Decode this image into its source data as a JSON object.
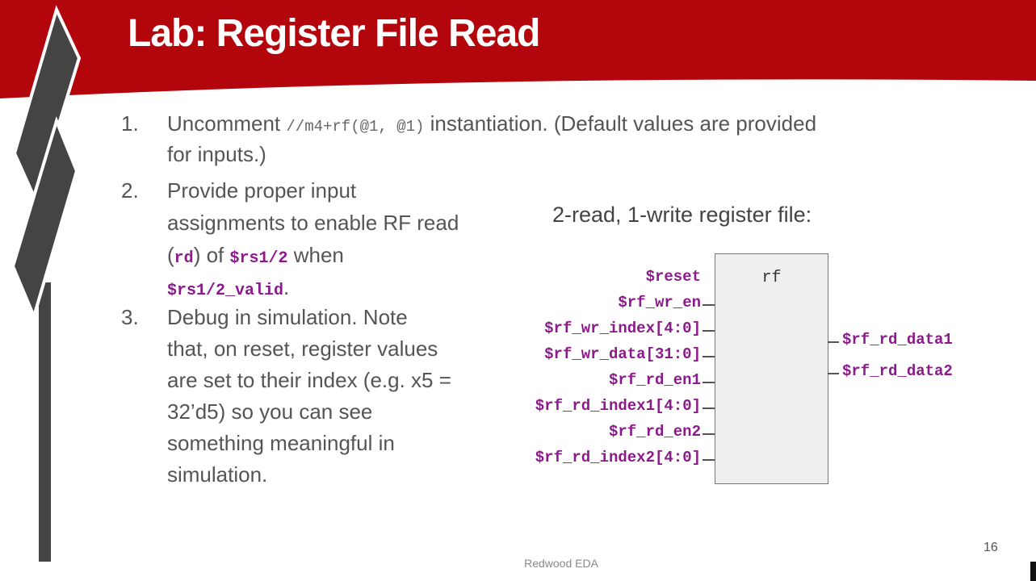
{
  "slide": {
    "title": "Lab: Register File Read",
    "colors": {
      "banner": "#b3060c",
      "signal": "#8b1a8b",
      "text": "#555555"
    },
    "steps": [
      {
        "number": "1.",
        "line1_pre": "Uncomment ",
        "line1_code": "//m4+rf(@1, @1)",
        "line1_post": " instantiation. (Default values are provided",
        "line2": "for inputs.)"
      },
      {
        "number": "2.",
        "line1": "Provide proper input",
        "line2": "assignments to enable RF read",
        "line3_pre": "(",
        "line3_code": "rd",
        "line3_mid": ") of ",
        "line3_sig": "$rs1/2",
        "line3_post": " when",
        "line4_sig": "$rs1/2_valid",
        "line4_post": "."
      },
      {
        "number": "3.",
        "line1": "Debug in simulation. Note",
        "line2": "that, on reset, register values",
        "line3": "are set to their index (e.g. x5 =",
        "line4": "32’d5) so you can see",
        "line5": "something meaningful in",
        "line6": "simulation."
      }
    ],
    "diagram": {
      "title": "2-read, 1-write register file:",
      "block_label": "rf",
      "inputs": [
        "$reset",
        "$rf_wr_en",
        "$rf_wr_index[4:0]",
        "$rf_wr_data[31:0]",
        "$rf_rd_en1",
        "$rf_rd_index1[4:0]",
        "$rf_rd_en2",
        "$rf_rd_index2[4:0]"
      ],
      "outputs": [
        "$rf_rd_data1",
        "$rf_rd_data2"
      ]
    },
    "footer": "Redwood EDA",
    "page_number": "16"
  }
}
